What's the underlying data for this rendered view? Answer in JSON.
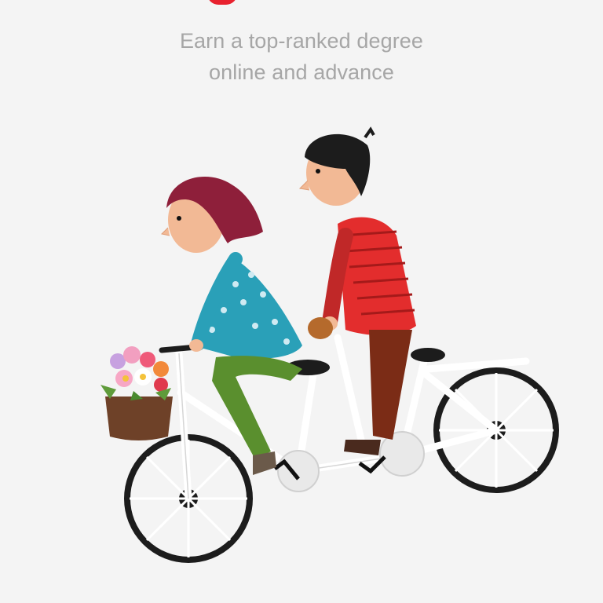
{
  "hero": {
    "tagline_line1": "Earn a top-ranked degree",
    "tagline_line2": "online and advance"
  },
  "colors": {
    "background": "#f4f4f4",
    "accent": "#e8212e",
    "tagline": "#a6a6a6"
  },
  "illustration": {
    "subject": "tandem-bicycle-riders-illustration"
  }
}
